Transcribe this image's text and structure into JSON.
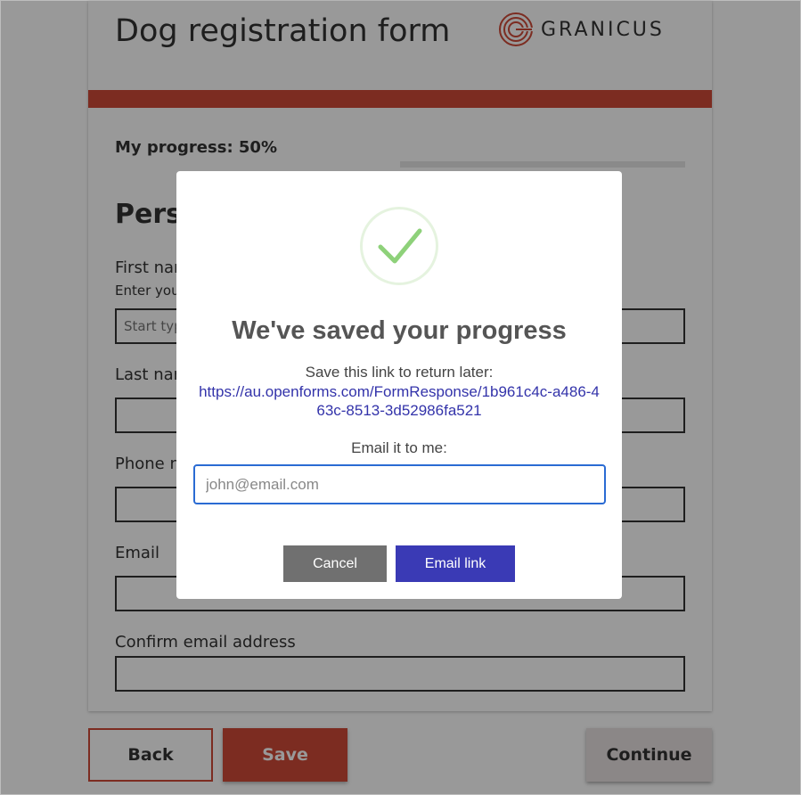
{
  "form": {
    "title": "Dog registration form",
    "logo_text": "GRANICUS",
    "progress_label": "My progress: 50%",
    "progress_value": 0.5,
    "section_title": "Persc",
    "fields": {
      "first_name_label": "First nar",
      "first_name_hint": "Enter you",
      "first_name_placeholder": "Start typ",
      "last_name_label": "Last nar",
      "phone_label": "Phone n",
      "email_label": "Email",
      "confirm_email_label": "Confirm email address"
    },
    "buttons": {
      "back": "Back",
      "save": "Save",
      "continue": "Continue"
    }
  },
  "modal": {
    "title": "We've saved your progress",
    "save_text": "Save this link to return later:",
    "link": "https://au.openforms.com/FormResponse/1b961c4c-a486-463c-8513-3d52986fa521",
    "email_label": "Email it to me:",
    "email_placeholder": "john@email.com",
    "cancel_label": "Cancel",
    "email_button_label": "Email link"
  },
  "colors": {
    "brand_red": "#cf4a38",
    "primary_blue": "#3a3ab5",
    "check_green": "#8ed17a",
    "focus_blue": "#2a6bd3"
  },
  "icons": {
    "logo": "granicus-logo-icon",
    "success": "checkmark-icon"
  }
}
